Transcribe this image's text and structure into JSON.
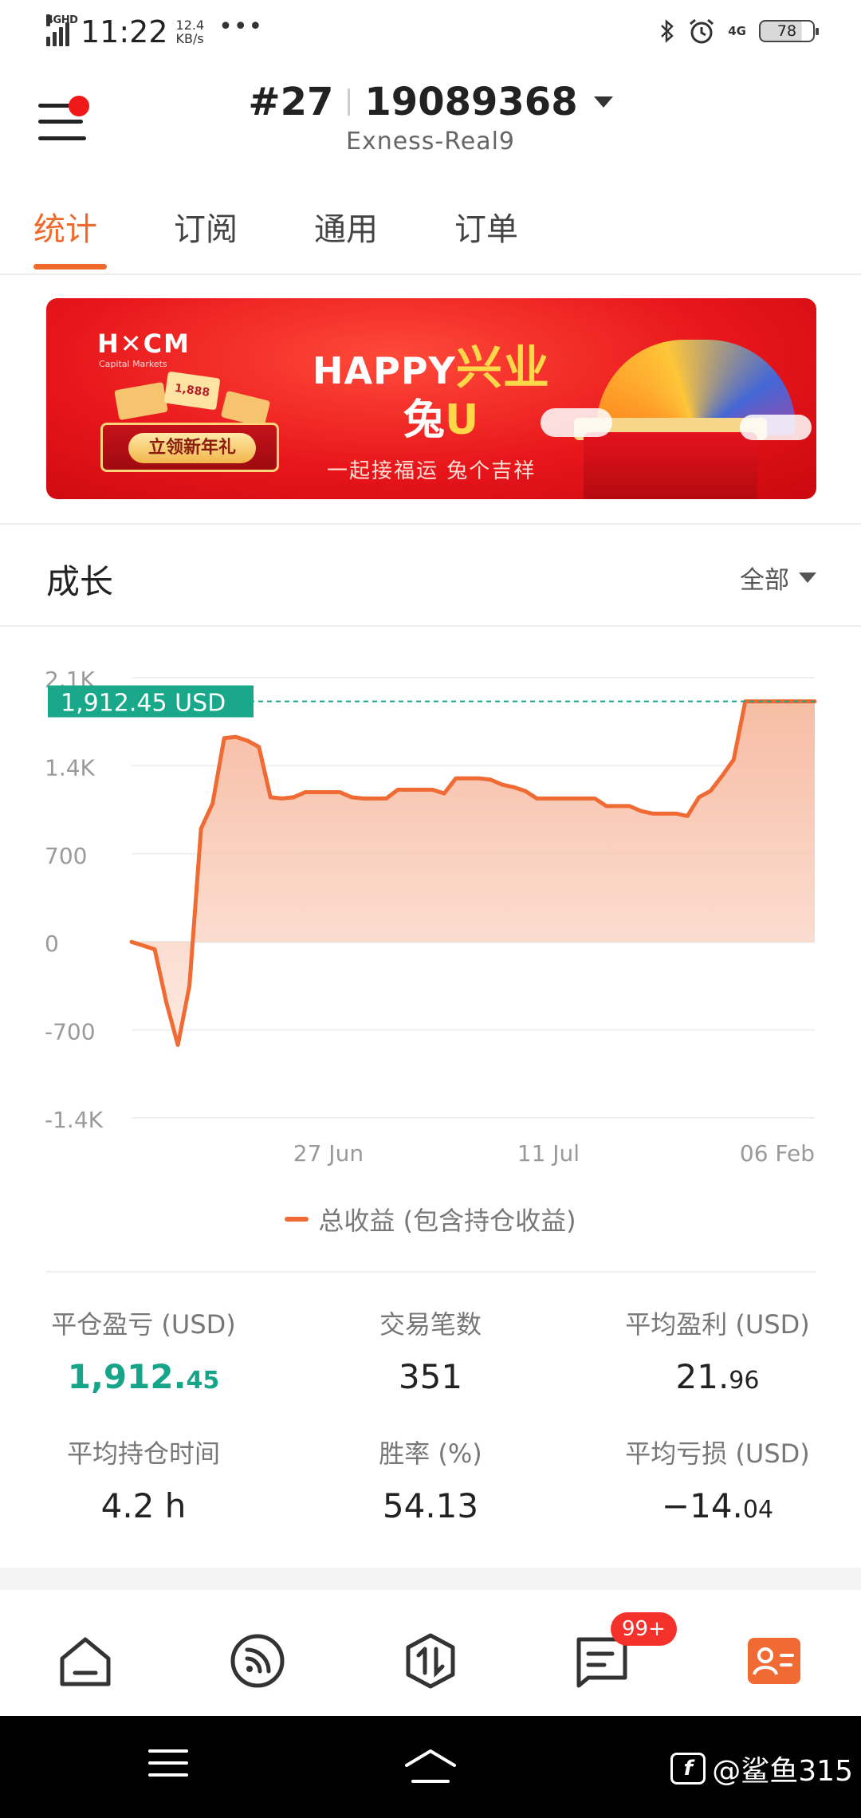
{
  "status_bar": {
    "network_tag": "4GHD",
    "time": "11:22",
    "speed_value": "12.4",
    "speed_unit": "KB/s",
    "more": "•••",
    "bluetooth_icon": "bluetooth-icon",
    "alarm_icon": "alarm-icon",
    "network_4g": "4G",
    "battery": "78"
  },
  "header": {
    "account_prefix": "#27",
    "account_id": "19089368",
    "server": "Exness-Real9"
  },
  "tabs": [
    {
      "label": "统计",
      "active": true
    },
    {
      "label": "订阅",
      "active": false
    },
    {
      "label": "通用",
      "active": false
    },
    {
      "label": "订单",
      "active": false
    }
  ],
  "banner": {
    "logo": "H✕CM",
    "logo_sub": "Capital Markets",
    "card_value": "1,888",
    "button": "立领新年礼",
    "title_a": "HAPPY",
    "title_b": "兴业",
    "title_c": "兔",
    "title_d": "U",
    "slogan": "一起接福运 兔个吉祥"
  },
  "growth": {
    "title": "成长",
    "filter": "全部"
  },
  "chart_data": {
    "type": "area",
    "title": "",
    "series": [
      {
        "name": "总收益 (包含持仓收益)",
        "color": "#f06a33",
        "x": [
          0,
          1,
          2,
          3,
          4,
          5,
          6,
          7,
          8,
          9,
          10,
          11,
          12,
          13,
          14,
          15,
          16,
          17,
          18,
          19,
          20,
          21,
          22,
          23,
          24,
          25,
          26,
          27,
          28,
          29,
          30,
          31,
          32,
          33,
          34,
          35,
          36,
          37,
          38,
          39,
          40,
          41,
          42,
          43,
          44,
          45,
          46,
          47,
          48,
          49,
          50,
          51,
          52,
          53,
          54,
          55,
          56,
          57,
          58,
          59
        ],
        "values": [
          0,
          -30,
          -60,
          -480,
          -820,
          -350,
          900,
          1100,
          1620,
          1630,
          1600,
          1550,
          1150,
          1140,
          1150,
          1190,
          1190,
          1190,
          1190,
          1150,
          1140,
          1140,
          1140,
          1210,
          1210,
          1210,
          1210,
          1180,
          1300,
          1300,
          1300,
          1290,
          1250,
          1230,
          1200,
          1140,
          1140,
          1140,
          1140,
          1140,
          1140,
          1080,
          1080,
          1080,
          1040,
          1020,
          1020,
          1020,
          1000,
          1150,
          1200,
          1320,
          1450,
          1912,
          1912,
          1912,
          1912,
          1912,
          1912,
          1912
        ]
      }
    ],
    "y_ticks": [
      "2.1K",
      "1.4K",
      "700",
      "0",
      "-700",
      "-1.4K"
    ],
    "y_tick_values": [
      2100,
      1400,
      700,
      0,
      -700,
      -1400
    ],
    "ylim": [
      -1400,
      2100
    ],
    "x_ticks": [
      "27 Jun",
      "11 Jul",
      "06 Feb"
    ],
    "x_tick_positions": [
      17,
      36,
      59
    ],
    "current_value_label": "1,912.45 USD",
    "current_value": 1912.45,
    "grid": true
  },
  "legend": {
    "label": "总收益 (包含持仓收益)"
  },
  "stats": {
    "closed_pnl_label": "平仓盈亏 (USD)",
    "closed_pnl_int": "1,912.",
    "closed_pnl_dec": "45",
    "trades_label": "交易笔数",
    "trades": "351",
    "avg_profit_label": "平均盈利 (USD)",
    "avg_profit_int": "21.",
    "avg_profit_dec": "96",
    "avg_hold_label": "平均持仓时间",
    "avg_hold": "4.2 h",
    "win_rate_label": "胜率 (%)",
    "win_rate": "54.13",
    "avg_loss_label": "平均亏损 (USD)",
    "avg_loss_int": "−14.",
    "avg_loss_dec": "04"
  },
  "bottom_nav": {
    "badge": "99+",
    "accent": "#f06a33"
  },
  "watermark": {
    "text": "@鲨鱼315",
    "logo": "f"
  }
}
